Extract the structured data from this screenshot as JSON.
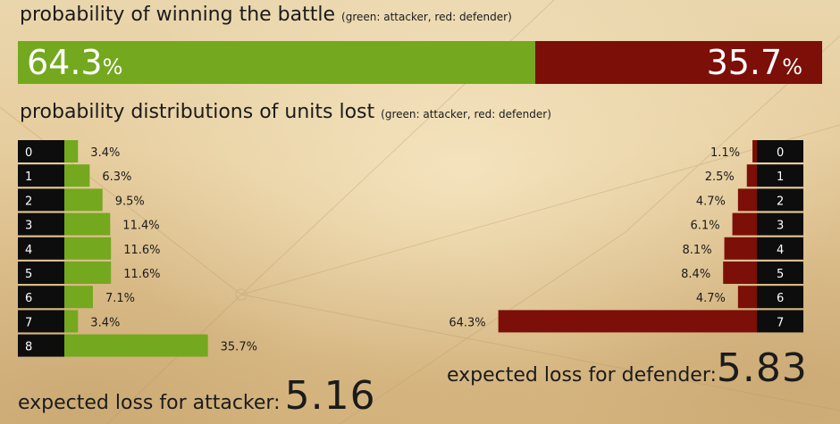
{
  "title": "probability of winning the battle",
  "title_note": "(green: attacker, red: defender)",
  "dist_title": "probability distributions of units lost",
  "dist_note": "(green: attacker, red: defender)",
  "colors": {
    "attacker": "#74a81e",
    "defender": "#7c0f07",
    "label_box": "#0d0d0d"
  },
  "win": {
    "attacker": 64.3,
    "defender": 35.7,
    "attacker_text": "64.3",
    "defender_text": "35.7",
    "pct": "%"
  },
  "chart_data": [
    {
      "type": "bar",
      "title": "probability of winning the battle",
      "series": [
        {
          "name": "attacker",
          "values": [
            64.3
          ]
        },
        {
          "name": "defender",
          "values": [
            35.7
          ]
        }
      ]
    },
    {
      "type": "bar",
      "title": "probability distributions of units lost",
      "attacker": {
        "categories": [
          "0",
          "1",
          "2",
          "3",
          "4",
          "5",
          "6",
          "7",
          "8"
        ],
        "values": [
          3.4,
          6.3,
          9.5,
          11.4,
          11.6,
          11.6,
          7.1,
          3.4,
          35.7
        ],
        "labels": [
          "3.4%",
          "6.3%",
          "9.5%",
          "11.4%",
          "11.6%",
          "11.6%",
          "7.1%",
          "3.4%",
          "35.7%"
        ]
      },
      "defender": {
        "categories": [
          "0",
          "1",
          "2",
          "3",
          "4",
          "5",
          "6",
          "7"
        ],
        "values": [
          1.1,
          2.5,
          4.7,
          6.1,
          8.1,
          8.4,
          4.7,
          64.3
        ],
        "labels": [
          "1.1%",
          "2.5%",
          "4.7%",
          "6.1%",
          "8.1%",
          "8.4%",
          "4.7%",
          "64.3%"
        ]
      }
    }
  ],
  "expected": {
    "attacker_label": "expected loss for attacker:",
    "attacker_value": "5.16",
    "defender_label": "expected loss for defender:",
    "defender_value": "5.83"
  }
}
